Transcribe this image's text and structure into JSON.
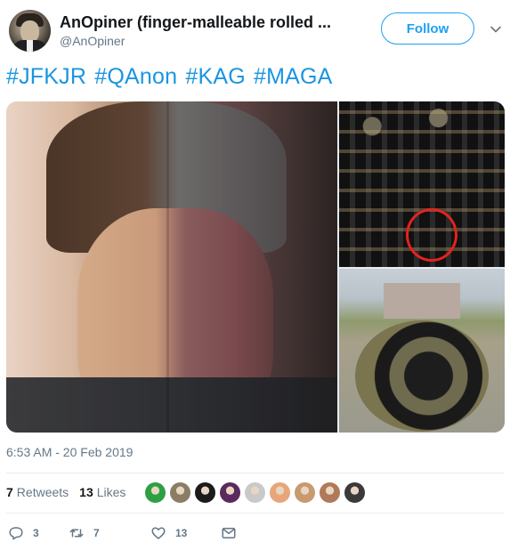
{
  "user": {
    "display_name": "AnOpiner (finger-malleable rolled ...",
    "handle": "@AnOpiner",
    "follow_label": "Follow"
  },
  "tweet": {
    "hashtags": [
      "#JFKJR",
      "#QAnon",
      "#KAG",
      "#MAGA"
    ],
    "timestamp": "6:53 AM - 20 Feb 2019"
  },
  "stats": {
    "retweets_count": "7",
    "retweets_label": "Retweets",
    "likes_count": "13",
    "likes_label": "Likes"
  },
  "likers": {
    "colors": [
      "#2ea043",
      "#8b7d64",
      "#1b1b1b",
      "#5a2a5d",
      "#c9c9c9",
      "#e7a67a",
      "#c89a6e",
      "#b07a5a",
      "#3a3a3a"
    ]
  },
  "actions": {
    "reply_count": "3",
    "retweet_count": "7",
    "like_count": "13"
  },
  "icons": {
    "reply": "reply-icon",
    "retweet": "retweet-icon",
    "like": "heart-icon",
    "message": "envelope-icon",
    "menu": "chevron-down-icon"
  },
  "colors": {
    "brand_blue": "#1da1f2",
    "hashtag_blue": "#1b95e0",
    "muted_gray": "#657786",
    "highlight_circle": "#e3231f"
  }
}
